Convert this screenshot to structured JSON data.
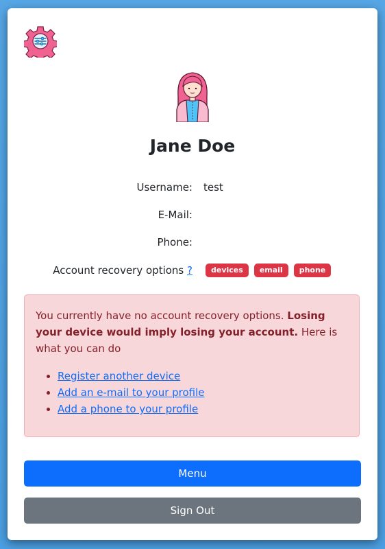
{
  "profile": {
    "name": "Jane Doe",
    "username_label": "Username:",
    "username_value": "test",
    "email_label": "E-Mail:",
    "email_value": "",
    "phone_label": "Phone:",
    "phone_value": "",
    "recovery_label": "Account recovery options",
    "recovery_help": "?",
    "recovery_badges": [
      "devices",
      "email",
      "phone"
    ]
  },
  "alert": {
    "text_before": "You currently have no account recovery options. ",
    "text_bold": "Losing your device would imply losing your account.",
    "text_after": " Here is what you can do",
    "links": [
      "Register another device",
      "Add an e-mail to your profile",
      "Add a phone to your profile"
    ]
  },
  "buttons": {
    "menu": "Menu",
    "sign_out": "Sign Out"
  },
  "colors": {
    "primary": "#0d6efd",
    "secondary": "#6c757d",
    "danger": "#dc3545",
    "alert_bg": "#f8d7da",
    "alert_text": "#842029"
  },
  "icons": {
    "settings": "gear-settings-icon",
    "avatar": "female-user-avatar"
  }
}
